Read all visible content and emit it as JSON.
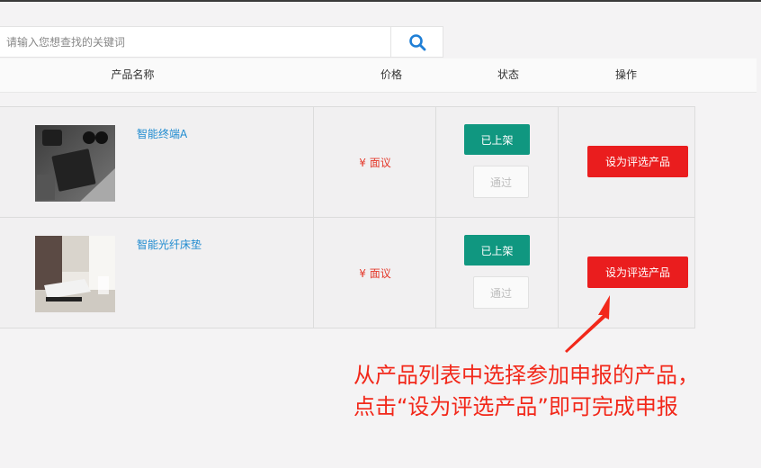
{
  "search": {
    "placeholder": "请输入您想查找的关键词"
  },
  "table": {
    "headers": {
      "name": "产品名称",
      "price": "价格",
      "status": "状态",
      "action": "操作"
    },
    "rows": [
      {
        "name": "智能终端A",
        "price": "¥ 面议",
        "status_button": "已上架",
        "review_button": "通过",
        "action_button": "设为评选产品"
      },
      {
        "name": "智能光纤床垫",
        "price": "¥ 面议",
        "status_button": "已上架",
        "review_button": "通过",
        "action_button": "设为评选产品"
      }
    ]
  },
  "annotation": {
    "line1": "从产品列表中选择参加申报的产品，",
    "line2": "点击“设为评选产品”即可完成申报"
  },
  "colors": {
    "accent_teal": "#109780",
    "action_red": "#ea1d1e",
    "link_blue": "#1f8bd0",
    "price_red": "#e4392b",
    "annotation_red": "#f2281a",
    "search_icon_blue": "#1f7fd6"
  },
  "icons": {
    "search": "search-icon",
    "arrow": "red-arrow-icon"
  }
}
